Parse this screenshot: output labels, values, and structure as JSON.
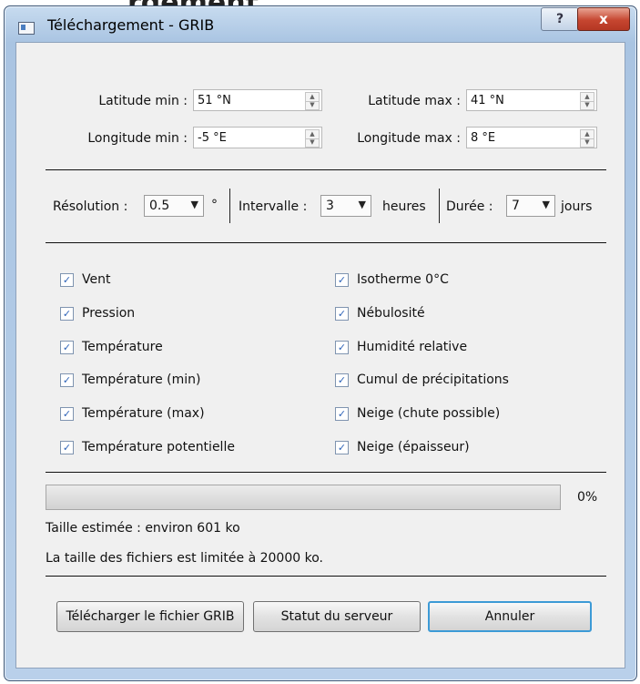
{
  "page_heading": "rgement",
  "window": {
    "title": "Téléchargement - GRIB",
    "help_label": "?",
    "close_label": "x"
  },
  "coords": {
    "lat_min_label": "Latitude min :",
    "lat_min_value": "51 °N",
    "lat_max_label": "Latitude max :",
    "lat_max_value": "41 °N",
    "lon_min_label": "Longitude min :",
    "lon_min_value": "-5 °E",
    "lon_max_label": "Longitude max :",
    "lon_max_value": "8 °E"
  },
  "settings": {
    "resolution_label": "Résolution :",
    "resolution_value": "0.5",
    "resolution_unit": "°",
    "interval_label": "Intervalle :",
    "interval_value": "3",
    "interval_unit": "heures",
    "duration_label": "Durée :",
    "duration_value": "7",
    "duration_unit": "jours"
  },
  "parameters": {
    "left": [
      {
        "label": "Vent",
        "checked": true
      },
      {
        "label": "Pression",
        "checked": true
      },
      {
        "label": "Température",
        "checked": true
      },
      {
        "label": "Température (min)",
        "checked": true
      },
      {
        "label": "Température (max)",
        "checked": true
      },
      {
        "label": "Température potentielle",
        "checked": true
      }
    ],
    "right": [
      {
        "label": "Isotherme 0°C",
        "checked": true
      },
      {
        "label": "Nébulosité",
        "checked": true
      },
      {
        "label": "Humidité relative",
        "checked": true
      },
      {
        "label": "Cumul de précipitations",
        "checked": true
      },
      {
        "label": "Neige (chute possible)",
        "checked": true
      },
      {
        "label": "Neige (épaisseur)",
        "checked": true
      }
    ]
  },
  "progress": {
    "fraction": 0,
    "percent_text": "0%"
  },
  "info": {
    "estimated_size": "Taille estimée : environ 601 ko",
    "size_limit": "La taille des fichiers est limitée à 20000 ko."
  },
  "buttons": {
    "download": "Télécharger le fichier GRIB",
    "server_status": "Statut du serveur",
    "cancel": "Annuler"
  },
  "icons": {
    "check": "check-icon",
    "spin": "spin-arrows-icon",
    "dropdown": "chevron-down-icon"
  },
  "colors": {
    "accent": "#3c9ad6",
    "close_button": "#c64630",
    "check_mark": "#2f64b8"
  }
}
